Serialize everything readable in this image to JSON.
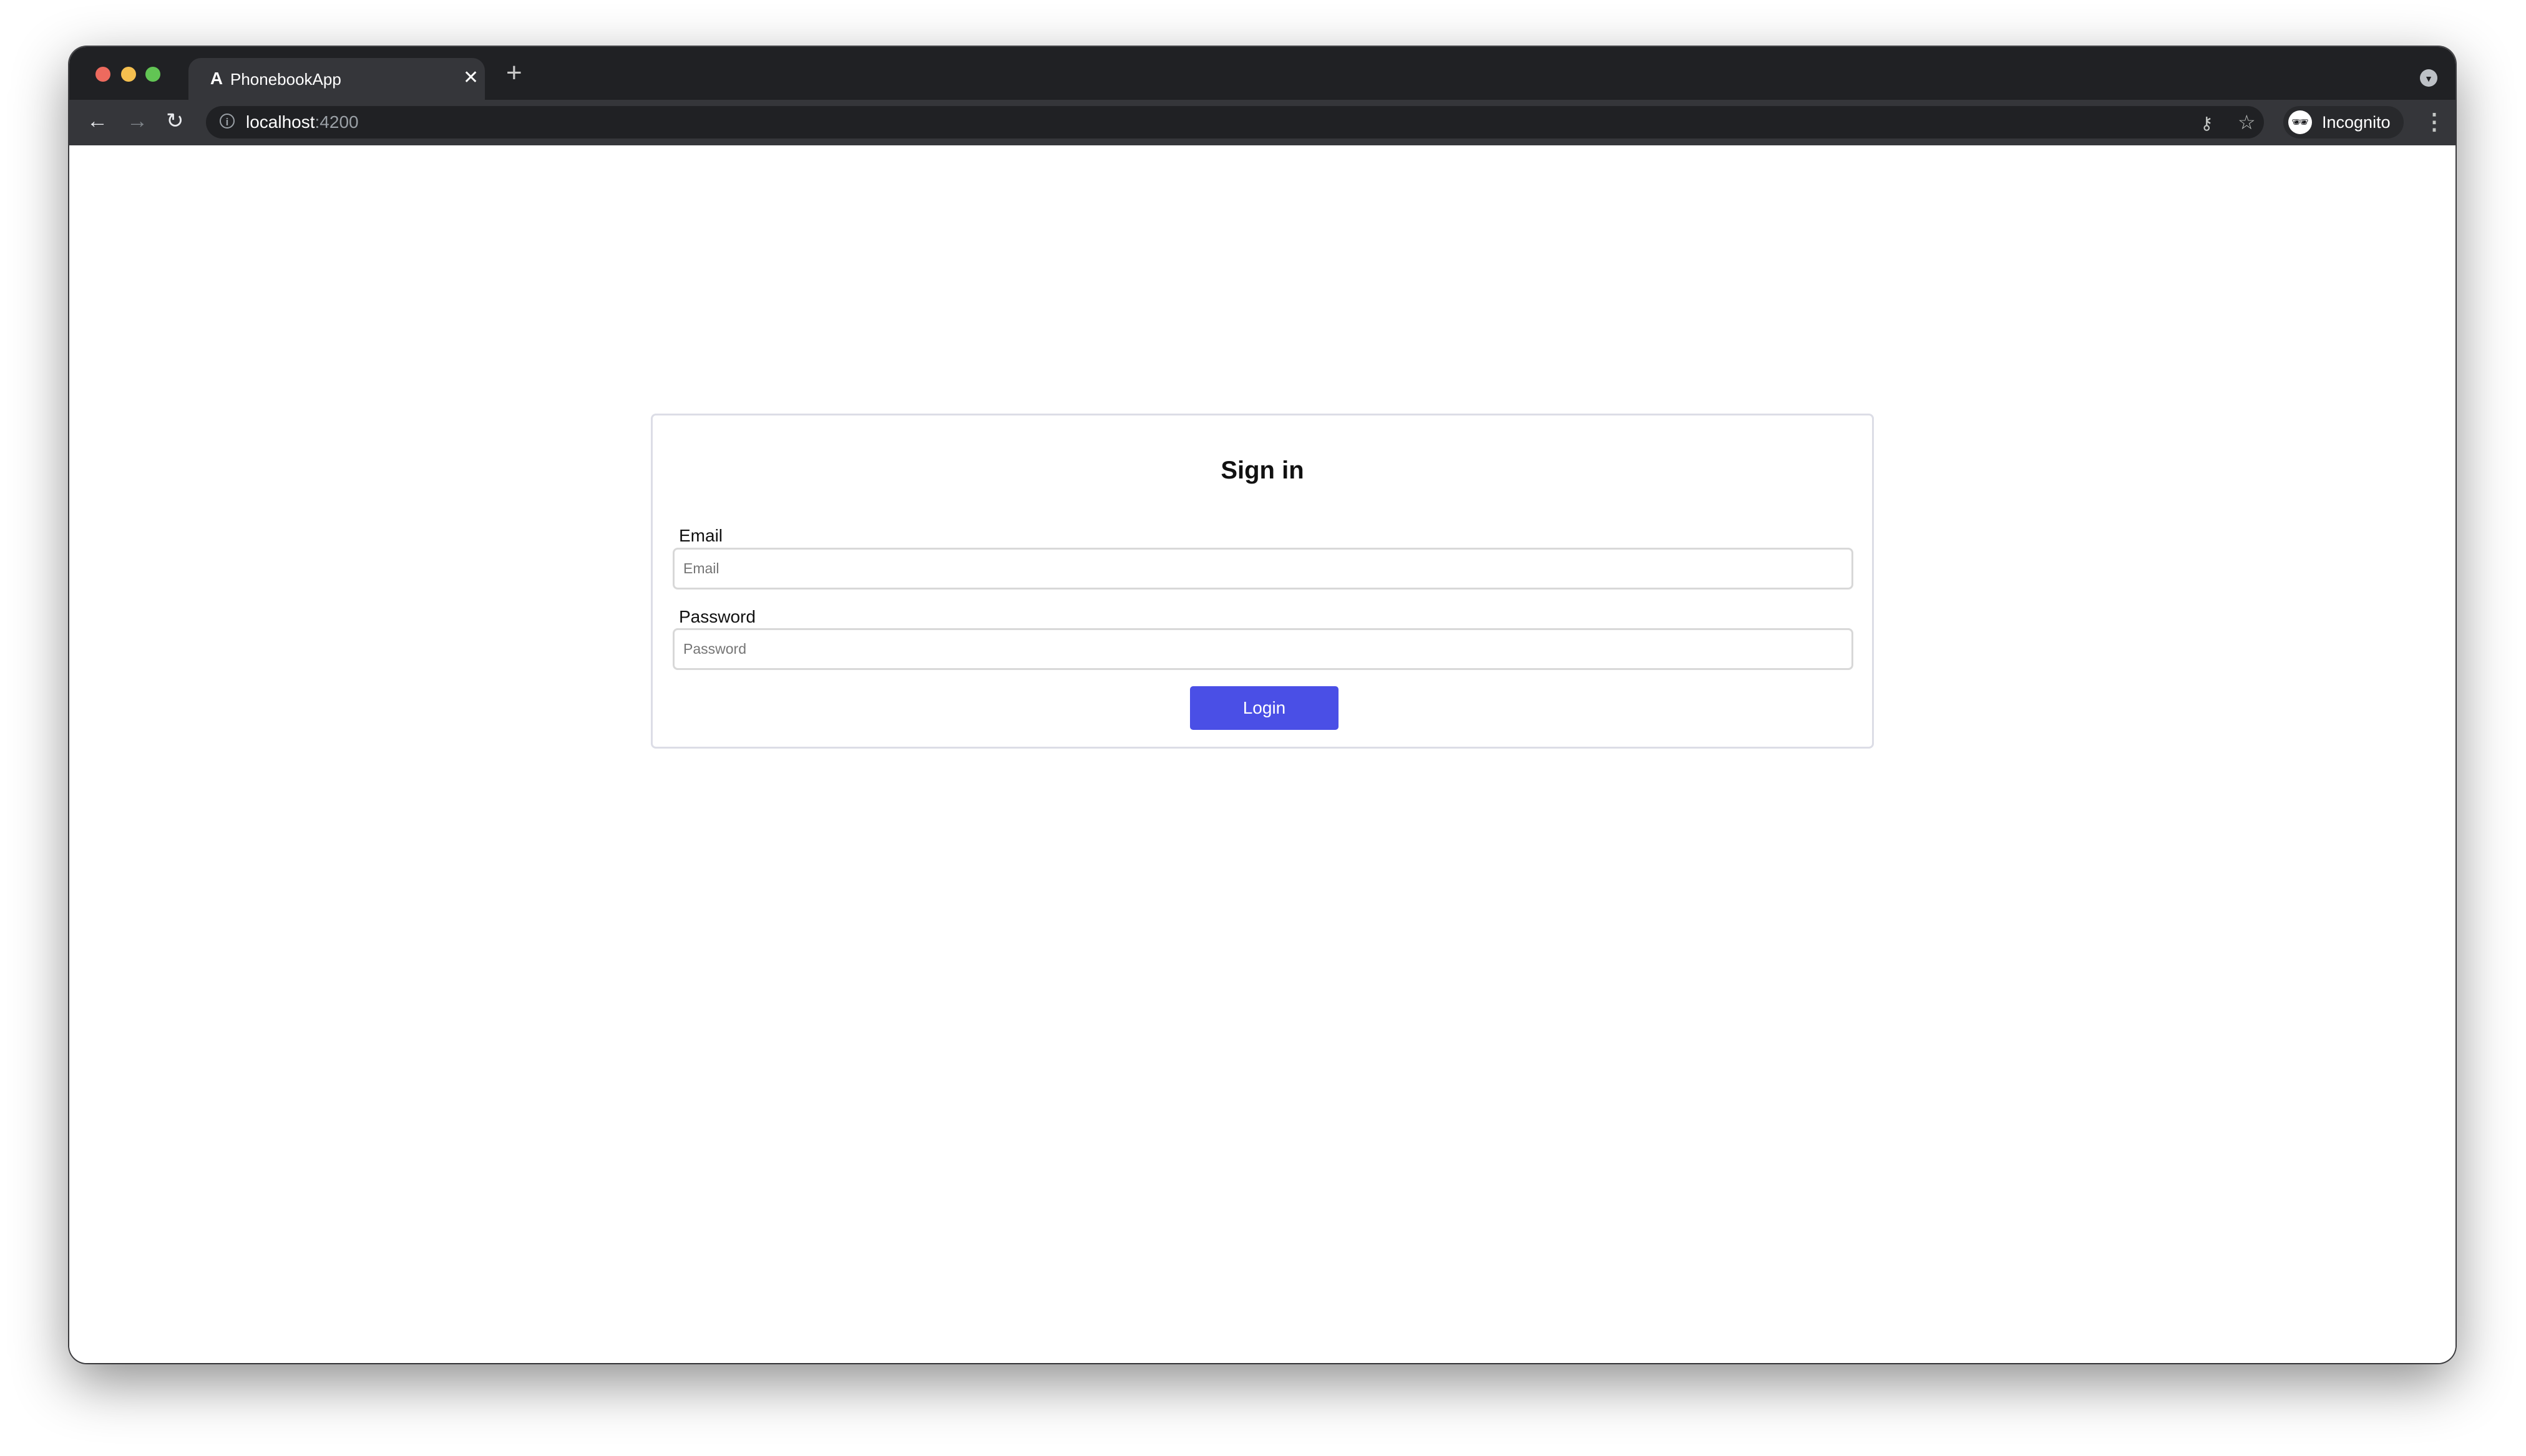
{
  "browser": {
    "tab_title": "PhonebookApp",
    "tab_favicon": "A",
    "url_host": "localhost",
    "url_port": ":4200",
    "profile_label": "Incognito",
    "icons": {
      "back": "arrow-left-icon",
      "forward": "arrow-right-icon",
      "reload": "reload-icon",
      "info": "info-icon",
      "key": "key-icon",
      "star": "star-icon",
      "incognito": "incognito-icon",
      "menu": "kebab-menu-icon",
      "new_tab": "plus-icon",
      "close_tab": "close-icon"
    },
    "traffic_lights": [
      "#ed6a5e",
      "#f5bf4f",
      "#62c554"
    ]
  },
  "form": {
    "title": "Sign in",
    "email_label": "Email",
    "email_placeholder": "Email",
    "email_value": "",
    "password_label": "Password",
    "password_placeholder": "Password",
    "password_value": "",
    "login_label": "Login",
    "accent_color": "#4a4fe6"
  }
}
